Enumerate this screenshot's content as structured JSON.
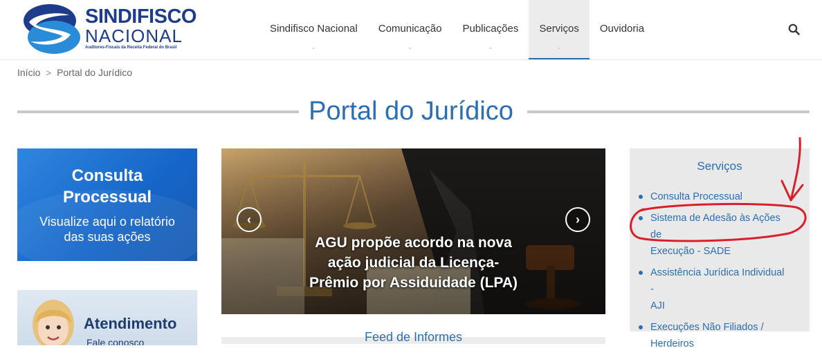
{
  "header": {
    "logo": {
      "title": "SINDIFISCO",
      "subtitle": "NACIONAL",
      "tagline": "Auditores-Fiscais da Receita Federal do Brasil"
    },
    "nav": [
      {
        "label": "Sindifisco Nacional",
        "active": false
      },
      {
        "label": "Comunicação",
        "active": false
      },
      {
        "label": "Publicações",
        "active": false
      },
      {
        "label": "Serviços",
        "active": true
      },
      {
        "label": "Ouvidoria",
        "active": false
      }
    ],
    "search_icon": "search-icon",
    "chevron_icon": "chevron-down-icon"
  },
  "breadcrumb": {
    "home": "Início",
    "separator": ">",
    "current": "Portal do Jurídico"
  },
  "page_title": "Portal do Jurídico",
  "promos": {
    "consulta": {
      "heading_line1": "Consulta",
      "heading_line2": "Processual",
      "sub_line1": "Visualize aqui o relatório",
      "sub_line2": "das suas ações"
    },
    "atendimento": {
      "heading": "Atendimento",
      "sub": "Fale conosco"
    }
  },
  "carousel": {
    "caption_line1": "AGU propõe acordo na nova",
    "caption_line2": "ação judicial da Licença-",
    "caption_line3": "Prêmio por Assiduidade (LPA)",
    "prev_icon": "chevron-left-icon",
    "next_icon": "chevron-right-icon"
  },
  "feed": {
    "title": "Feed de Informes"
  },
  "sidebar": {
    "title": "Serviços",
    "items": [
      {
        "line1": "Consulta Processual",
        "line2": ""
      },
      {
        "line1": "Sistema de Adesão às Ações de",
        "line2": "Execução - SADE"
      },
      {
        "line1": "Assistência Jurídica Individual -",
        "line2": "AJI"
      },
      {
        "line1": "Execuções Não Filiados /",
        "line2": "Herdeiros"
      }
    ]
  },
  "colors": {
    "brand_blue": "#2a6eb3",
    "logo_navy": "#1e3c8c",
    "annotation_red": "#d9202a"
  }
}
